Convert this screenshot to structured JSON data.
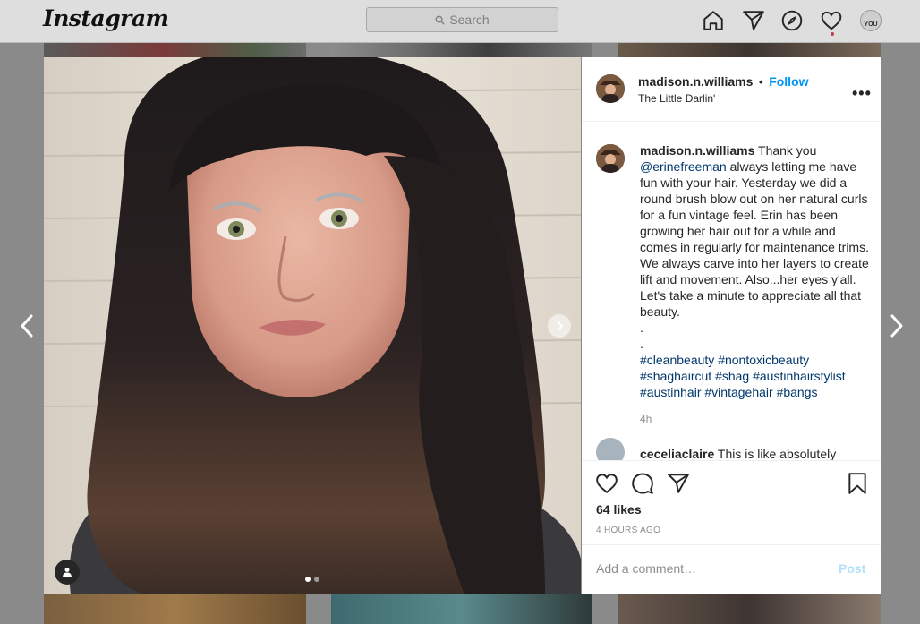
{
  "nav": {
    "logo": "Instagram",
    "search_placeholder": "Search",
    "icons": [
      "home-icon",
      "direct-icon",
      "explore-icon",
      "activity-icon",
      "profile-avatar"
    ],
    "avatar_label": "YOU"
  },
  "post": {
    "username": "madison.n.williams",
    "separator": "•",
    "follow_label": "Follow",
    "location": "The Little Darlin'",
    "more_label": "•••",
    "image_count": 2,
    "active_image": 1
  },
  "caption": {
    "username": "madison.n.williams",
    "text_before": " Thank you ",
    "mention": "@erinefreeman",
    "text_after": " always letting me have fun with your hair. Yesterday we did a round brush blow out on her natural curls for a fun vintage feel. Erin has been growing her hair out for a while and comes in regularly for maintenance trims. We always carve into her layers to create lift and movement. Also...her eyes y'all. Let's take a minute to appreciate all that beauty.",
    "dots": [
      ".",
      "."
    ],
    "hashtags": [
      "#cleanbeauty",
      "#nontoxicbeauty",
      "#shaghaircut",
      "#shag",
      "#austinhairstylist",
      "#austinhair",
      "#vintagehair",
      "#bangs"
    ],
    "time": "4h"
  },
  "next_comment": {
    "username": "ceceliaclaire",
    "text": " This is like absolutely"
  },
  "stats": {
    "likes": "64 likes",
    "posted": "4 HOURS AGO"
  },
  "comment_box": {
    "placeholder": "Add a comment…",
    "post_label": "Post"
  },
  "colors": {
    "link_blue": "#0095f6",
    "hashtag_navy": "#00376b",
    "post_disabled": "#b2dffc",
    "notification_dot": "#c23b4b"
  }
}
